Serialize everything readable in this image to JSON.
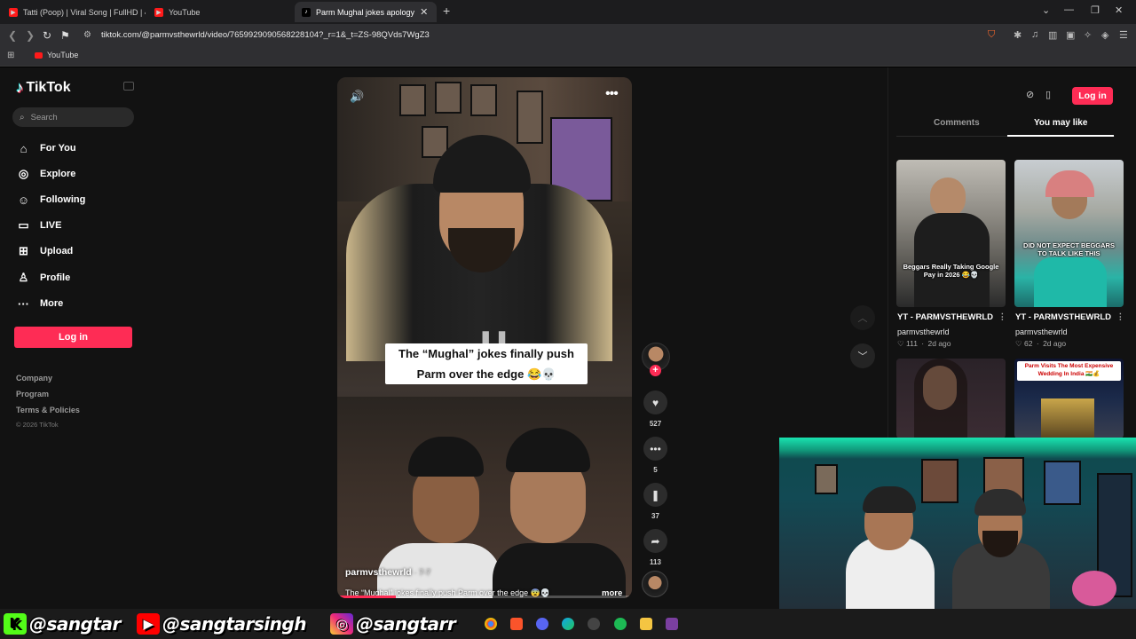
{
  "browser": {
    "tabs": [
      {
        "label": "Tatti (Poop) | Viral Song | FullHD | 4K",
        "icon": "youtube-icon",
        "active": false
      },
      {
        "label": "YouTube",
        "icon": "youtube-icon",
        "active": false
      },
      {
        "label": "Parm Mughal jokes apology",
        "icon": "tiktok-icon",
        "active": true
      }
    ],
    "url": "tiktok.com/@parmvsthewrld/video/7659929090568228104?_r=1&_t=ZS-98QVds7WgZ3",
    "bookmarks": [
      {
        "label": "YouTube",
        "icon": "youtube-icon"
      }
    ]
  },
  "sidebar": {
    "logo": "TikTok",
    "search_placeholder": "Search",
    "nav": [
      {
        "label": "For You",
        "icon": "home-icon"
      },
      {
        "label": "Explore",
        "icon": "compass-icon"
      },
      {
        "label": "Following",
        "icon": "following-icon"
      },
      {
        "label": "LIVE",
        "icon": "live-icon"
      },
      {
        "label": "Upload",
        "icon": "upload-icon"
      },
      {
        "label": "Profile",
        "icon": "profile-icon"
      },
      {
        "label": "More",
        "icon": "more-icon"
      }
    ],
    "login_label": "Log in",
    "footer_links": [
      "Company",
      "Program",
      "Terms & Policies"
    ],
    "copyright": "© 2026 TikTok"
  },
  "video": {
    "caption": "The “Mughal” jokes finally push Parm over the edge 😂💀",
    "author": "parmvsthewrld",
    "date": "· 7-7",
    "description": "The “Mughal” jokes finally push Parm over the edge 😨💀",
    "more_label": "more",
    "progress": 0.2
  },
  "actions": {
    "likes": "527",
    "comments": "5",
    "saves": "37",
    "shares": "113"
  },
  "right_panel": {
    "login_label": "Log in",
    "tabs": [
      {
        "label": "Comments",
        "active": false
      },
      {
        "label": "You may like",
        "active": true
      }
    ],
    "cards": [
      {
        "overlay": "Beggars Really Taking Google Pay in 2026 😂💀",
        "title": "YT - PARMVSTHEWRLD",
        "user": "parmvsthewrld",
        "likes": "111",
        "age": "2d ago"
      },
      {
        "overlay": "DID NOT EXPECT BEGGARS TO TALK LIKE THIS",
        "title": "YT - PARMVSTHEWRLD",
        "user": "parmvsthewrld",
        "likes": "62",
        "age": "2d ago"
      },
      {
        "overlay": "",
        "title": "",
        "user": "",
        "likes": "",
        "age": ""
      },
      {
        "overlay": "Parm Visits The Most Expensive Wedding In India 🇮🇳💰",
        "title": "",
        "user": "",
        "likes": "",
        "age": ""
      }
    ]
  },
  "overlay_socials": [
    {
      "platform": "kick-icon",
      "handle": "@sangtar"
    },
    {
      "platform": "youtube-icon",
      "handle": "@sangtarsingh"
    },
    {
      "platform": "instagram-icon",
      "handle": "@sangtarr"
    }
  ],
  "colors": {
    "accent": "#fe2c55",
    "page_bg": "#121212"
  }
}
